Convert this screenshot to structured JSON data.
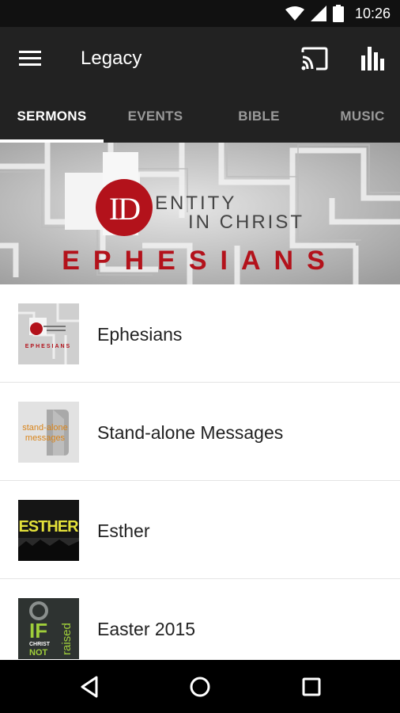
{
  "status_bar": {
    "time": "10:26",
    "icons": [
      "wifi-icon",
      "cell-signal-icon",
      "battery-icon"
    ]
  },
  "app_bar": {
    "title": "Legacy",
    "icons": [
      "menu-icon",
      "cast-icon",
      "stats-icon"
    ]
  },
  "tabs": [
    {
      "label": "SERMONS",
      "active": true
    },
    {
      "label": "EVENTS",
      "active": false
    },
    {
      "label": "BIBLE",
      "active": false
    },
    {
      "label": "MUSIC",
      "active": false
    }
  ],
  "banner": {
    "logo_letters": "ID",
    "line1": "ENTITY",
    "line2": "IN CHRIST",
    "headline": "EPHESIANS"
  },
  "sermon_series": [
    {
      "label": "Ephesians"
    },
    {
      "label": "Stand-alone Messages",
      "thumb_line1": "stand-alone",
      "thumb_line2": "messages"
    },
    {
      "label": "Esther",
      "thumb_text": "ESTHER"
    },
    {
      "label": "Easter 2015",
      "thumb_text_a": "IF",
      "thumb_text_b": "CHRIST",
      "thumb_text_c": "NOT",
      "thumb_text_d": "raised"
    }
  ],
  "nav_bar": {
    "icons": [
      "back-icon",
      "home-icon",
      "recents-icon"
    ]
  },
  "colors": {
    "app_bar": "#222222",
    "status_bar": "#111111",
    "accent_red": "#b3121b"
  }
}
